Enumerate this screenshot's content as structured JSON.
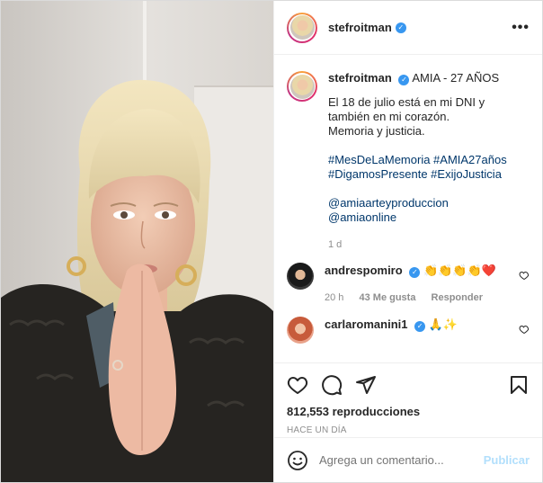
{
  "post": {
    "username": "stefroitman",
    "verified_mark": "✓",
    "more_icon": "more-horizontal-icon",
    "caption": {
      "username": "stefroitman",
      "title": "AMIA - 27 AÑOS",
      "lines": [
        "El 18 de julio está en mi DNI y",
        "también en mi corazón.",
        "Memoria y justicia."
      ],
      "hashtags": [
        "#MesDeLaMemoria #AMIA27años",
        "#DigamosPresente #ExijoJusticia"
      ],
      "mentions": [
        "@amiaarteyproduccion",
        "@amiaonline"
      ],
      "age": "1 d"
    },
    "comments": [
      {
        "username": "andrespomiro",
        "text": "👏👏👏👏❤️",
        "time": "20 h",
        "likes": "43 Me gusta",
        "reply": "Responder"
      },
      {
        "username": "carlaromanini1",
        "text": "🙏✨"
      }
    ],
    "views": "812,553 reproducciones",
    "posted": "HACE UN DÍA",
    "comment_placeholder": "Agrega un comentario...",
    "publish_label": "Publicar"
  },
  "colors": {
    "link": "#00376b",
    "verified": "#3897f0",
    "muted": "#8e8e8e",
    "publish": "#b2dffc"
  }
}
